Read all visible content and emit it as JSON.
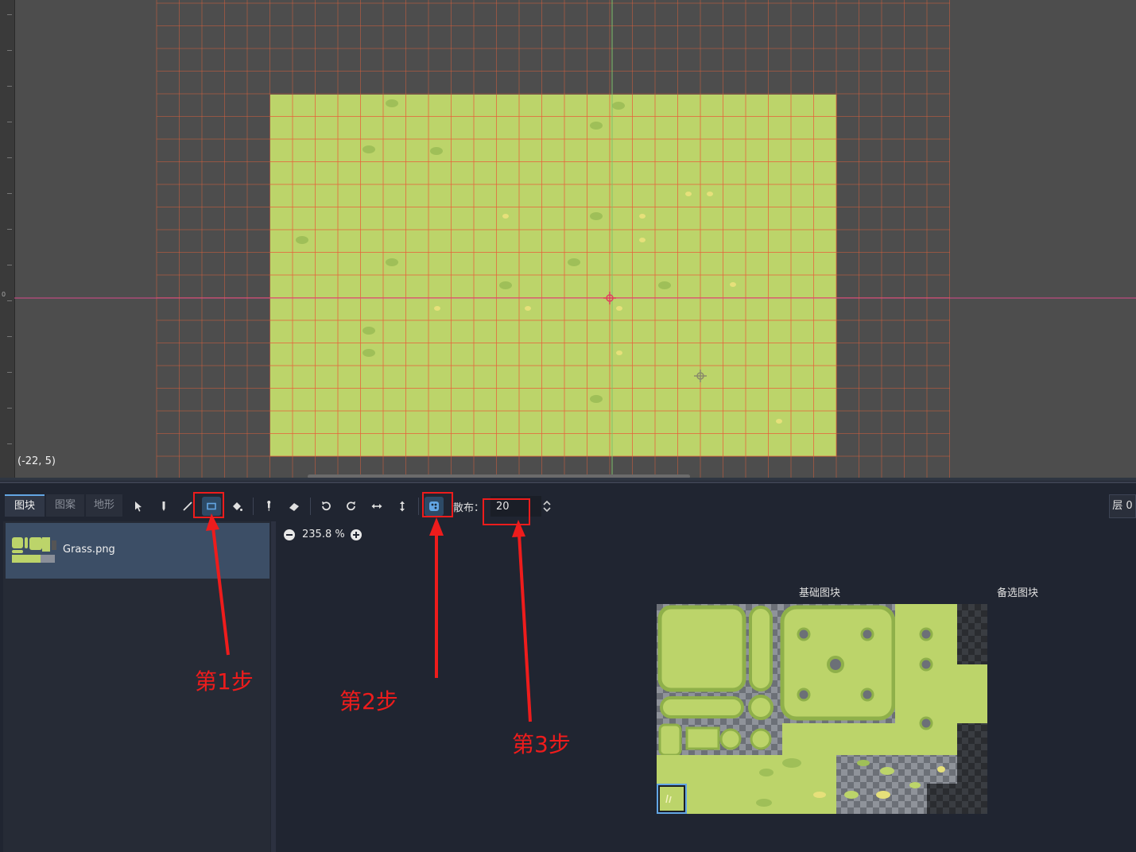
{
  "viewport": {
    "cursor_coordinates": "(-22, 5)",
    "ruler_zero_label": "0"
  },
  "bottom_panel": {
    "tabs": [
      {
        "label": "图块",
        "active": true
      },
      {
        "label": "图案",
        "active": false
      },
      {
        "label": "地形",
        "active": false
      }
    ],
    "tools": [
      {
        "name": "select",
        "icon": "arrow-cursor-icon"
      },
      {
        "name": "paint",
        "icon": "pencil-icon"
      },
      {
        "name": "line",
        "icon": "line-icon"
      },
      {
        "name": "rect",
        "icon": "rectangle-icon",
        "active": true
      },
      {
        "name": "bucket",
        "icon": "paint-bucket-icon"
      },
      {
        "name": "picker",
        "icon": "eyedropper-icon"
      },
      {
        "name": "eraser",
        "icon": "eraser-icon"
      },
      {
        "name": "rotate-left",
        "icon": "rotate-left-icon"
      },
      {
        "name": "rotate-right",
        "icon": "rotate-right-icon"
      },
      {
        "name": "flip-h",
        "icon": "flip-horizontal-icon"
      },
      {
        "name": "flip-v",
        "icon": "flip-vertical-icon"
      },
      {
        "name": "random",
        "icon": "dice-icon",
        "active": true
      }
    ],
    "scatter": {
      "label": "散布：",
      "value": "20"
    },
    "layer_button": "层 0",
    "tile_sources": [
      {
        "label": "Grass.png",
        "selected": true
      }
    ],
    "atlas": {
      "zoom": "235.8 %",
      "base_tiles_label": "基础图块",
      "alternative_tiles_label": "备选图块"
    }
  },
  "annotations": {
    "color": "#ee1c1c",
    "steps": [
      {
        "label": "第1步",
        "target": "rect-tool"
      },
      {
        "label": "第2步",
        "target": "random-tile-toggle"
      },
      {
        "label": "第3步",
        "target": "scatter-input"
      }
    ]
  },
  "colors": {
    "grass": "#bcd46a",
    "grid_line": "#e8613a",
    "accent": "#63a6e4",
    "viewport_bg": "#4d4d4d",
    "panel_bg": "#202531"
  }
}
